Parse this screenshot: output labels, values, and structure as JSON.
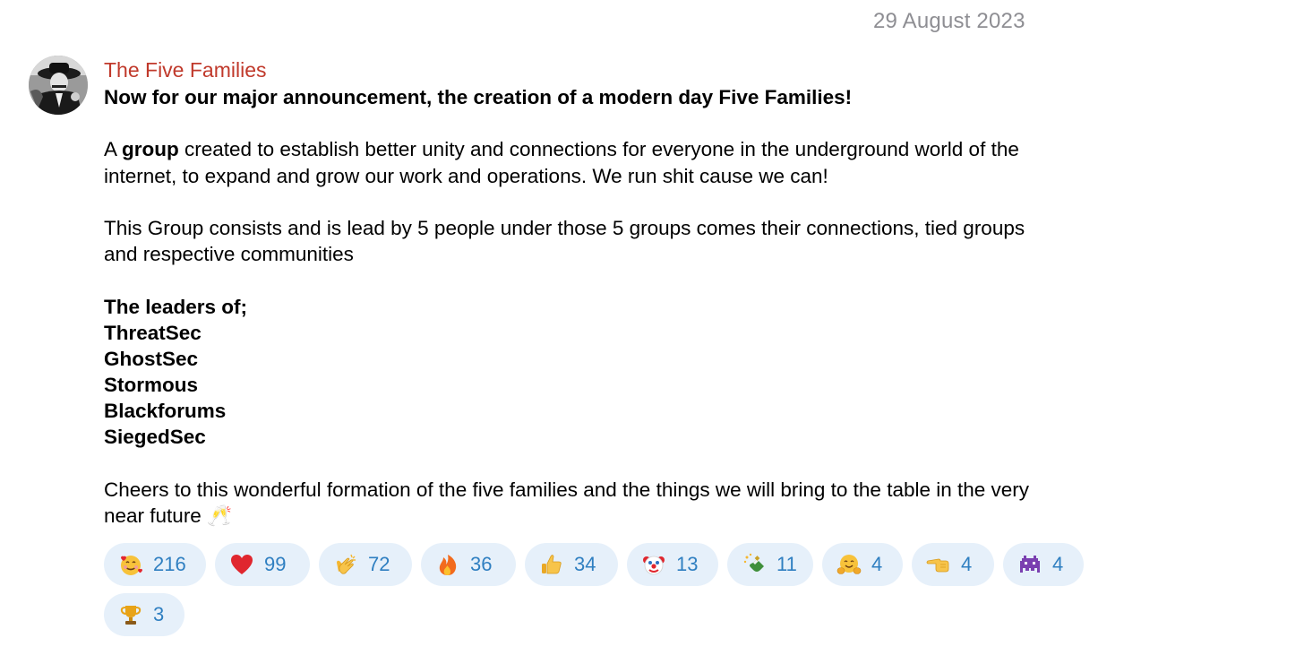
{
  "date_separator": "29 August 2023",
  "message": {
    "sender": "The Five Families",
    "headline": "Now for our major announcement, the creation of a modern day Five Families!",
    "para1_line1_prefix": "A ",
    "para1_line1_bold": "group",
    "para1_line1_suffix": " created to establish better unity and connections for everyone in the underground world of the",
    "para1_line2": "internet, to expand and grow our work and operations. We run shit cause we can!",
    "para2_line1": "This Group consists and is lead by 5 people under those 5 groups comes their connections, tied groups",
    "para2_line2": "and respective communities",
    "leaders_heading": "The leaders of;",
    "leaders": [
      "ThreatSec",
      "GhostSec",
      "Stormous",
      "Blackforums",
      "SiegedSec"
    ],
    "closing_line1": "Cheers to this wonderful formation of the five families and the things we will bring to the table in the very",
    "closing_line2": "near future 🥂"
  },
  "reactions": [
    {
      "icon": "smiling-face-with-hearts-icon",
      "count": "216",
      "color": "#f5a623"
    },
    {
      "icon": "red-heart-icon",
      "count": "99",
      "color": "#e0262e"
    },
    {
      "icon": "clapping-hands-icon",
      "count": "72",
      "color": "#f5b731"
    },
    {
      "icon": "fire-icon",
      "count": "36",
      "color": "#f26b1d"
    },
    {
      "icon": "thumbs-up-icon",
      "count": "34",
      "color": "#f5b731"
    },
    {
      "icon": "clown-face-icon",
      "count": "13",
      "color": "#e0262e"
    },
    {
      "icon": "champagne-bottle-icon",
      "count": "11",
      "color": "#3f8f3a"
    },
    {
      "icon": "hugging-face-icon",
      "count": "4",
      "color": "#f5b731"
    },
    {
      "icon": "pointing-hand-icon",
      "count": "4",
      "color": "#f5b731"
    },
    {
      "icon": "space-invader-icon",
      "count": "4",
      "color": "#7a3fb0"
    },
    {
      "icon": "trophy-icon",
      "count": "3",
      "color": "#e8a317"
    }
  ],
  "colors": {
    "sender_name": "#c0392b",
    "date": "#8e8e93",
    "reaction_bg": "#e6f0fa",
    "reaction_count": "#2f7fc1"
  }
}
